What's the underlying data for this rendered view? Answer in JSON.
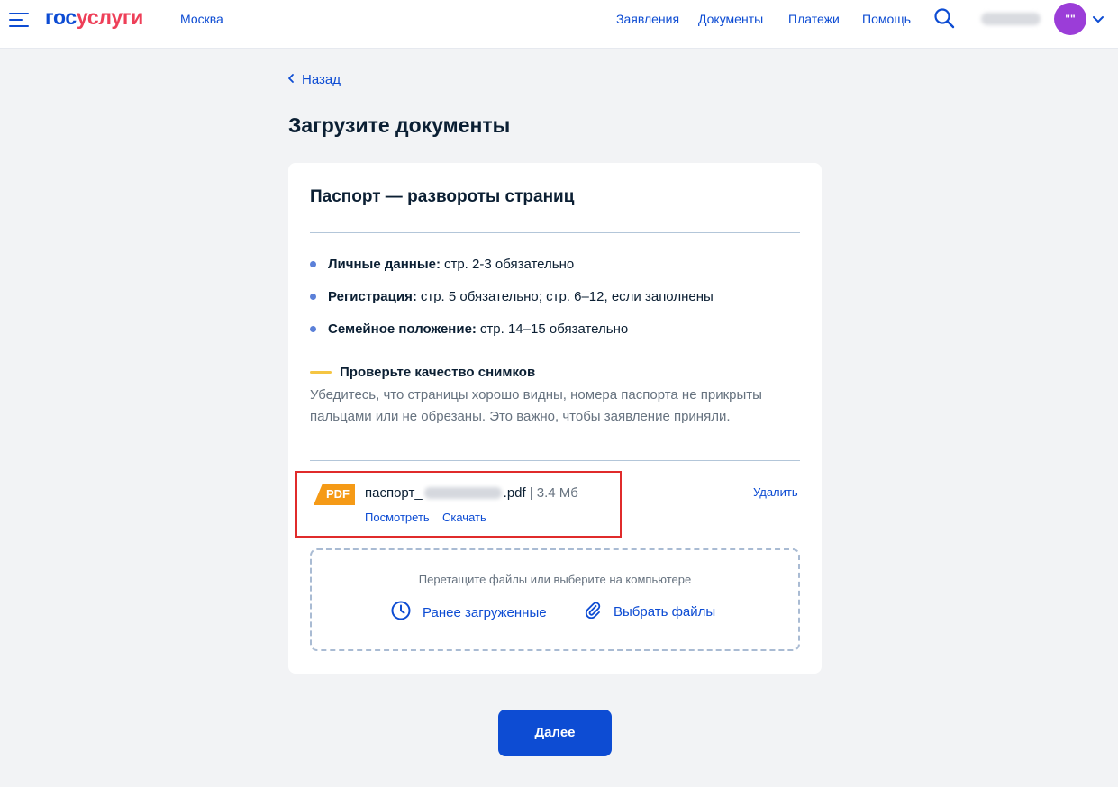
{
  "header": {
    "logo_part1": "гос",
    "logo_part2": "услуги",
    "city": "Москва",
    "nav": [
      "Заявления",
      "Документы",
      "Платежи",
      "Помощь"
    ],
    "avatar_initials": "\"\""
  },
  "page": {
    "back_label": "Назад",
    "title": "Загрузите документы"
  },
  "card": {
    "title": "Паспорт — развороты страниц",
    "requirements": [
      {
        "label": "Личные данные:",
        "text": "стр. 2-3 обязательно"
      },
      {
        "label": "Регистрация:",
        "text": "стр. 5 обязательно; стр. 6–12, если заполнены"
      },
      {
        "label": "Семейное положение:",
        "text": "стр. 14–15 обязательно"
      }
    ],
    "hint_title": "Проверьте качество снимков",
    "hint_text": "Убедитесь, что страницы хорошо видны, номера паспорта не прикрыты пальцами или не обрезаны. Это важно, чтобы заявление приняли."
  },
  "file": {
    "badge": "PDF",
    "name_prefix": "паспорт_",
    "name_suffix": ".pdf",
    "size": "| 3.4 Мб",
    "view_label": "Посмотреть",
    "download_label": "Скачать",
    "delete_label": "Удалить"
  },
  "dropzone": {
    "hint": "Перетащите файлы или выберите на компьютере",
    "previous_label": "Ранее загруженные",
    "choose_label": "Выбрать файлы"
  },
  "next_button": "Далее",
  "colors": {
    "accent": "#0d4cd3",
    "logo_red": "#ee3f58",
    "pdf_orange": "#f59a16",
    "highlight_border": "#e02b2b",
    "avatar_purple": "#9b3dd8"
  },
  "icons": [
    "menu-icon",
    "search-icon",
    "chevron-down-icon",
    "chevron-left-icon",
    "pdf-file-icon",
    "clock-icon",
    "paperclip-icon"
  ]
}
